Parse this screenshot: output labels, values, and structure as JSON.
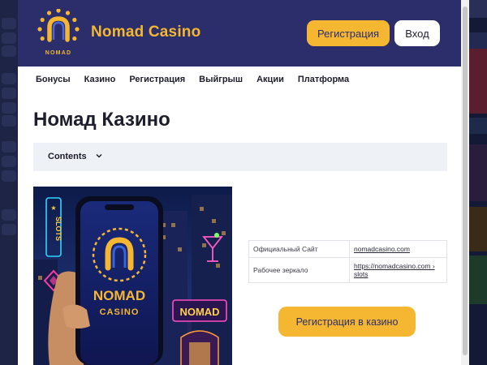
{
  "header": {
    "brand": "Nomad Casino",
    "logo_wordmark": "NOMAD",
    "register_button": "Регистрация",
    "login_button": "Вход"
  },
  "nav": {
    "items": [
      "Бонусы",
      "Казино",
      "Регистрация",
      "Выйгрыш",
      "Акции",
      "Платформа"
    ]
  },
  "main": {
    "title": "Номад Казино",
    "toc_label": "Contents",
    "hero_image": {
      "phone_brand": "NOMAD",
      "phone_sub": "CASINO",
      "neon_sign": "SLOTS",
      "building_sign": "NOMAD"
    },
    "info_table": [
      {
        "key": "Официальный Сайт",
        "value": "nomadcasino.com"
      },
      {
        "key": "Рабочее зеркало",
        "value": "https://nomadcasino.com › slots"
      }
    ],
    "cta_button": "Регистрация в казино"
  },
  "colors": {
    "header_bg": "#2b2e6b",
    "accent": "#f5b731",
    "page_bg": "#ffffff",
    "toc_bg": "#eef1f5"
  },
  "icons": [
    "nomad-logo-icon",
    "chevron-down-icon",
    "scrollbar"
  ]
}
